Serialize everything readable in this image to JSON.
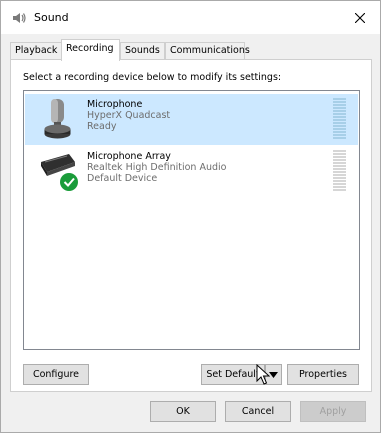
{
  "window": {
    "title": "Sound"
  },
  "tabs": [
    {
      "label": "Playback"
    },
    {
      "label": "Recording",
      "active": true
    },
    {
      "label": "Sounds"
    },
    {
      "label": "Communications"
    }
  ],
  "panel": {
    "instruction": "Select a recording device below to modify its settings:"
  },
  "devices": [
    {
      "name": "Microphone",
      "driver": "HyperX Quadcast",
      "status": "Ready",
      "selected": true,
      "icon": "microphone-icon"
    },
    {
      "name": "Microphone Array",
      "driver": "Realtek High Definition Audio",
      "status": "Default Device",
      "selected": false,
      "icon": "microphone-array-icon",
      "badge": "default-check-icon"
    }
  ],
  "buttons": {
    "configure": "Configure",
    "set_default": "Set Default",
    "properties": "Properties",
    "ok": "OK",
    "cancel": "Cancel",
    "apply": "Apply"
  },
  "colors": {
    "selected_row": "#cce8ff",
    "meter_segment": "#bfe3c8",
    "check_badge": "#1a9c3a"
  }
}
